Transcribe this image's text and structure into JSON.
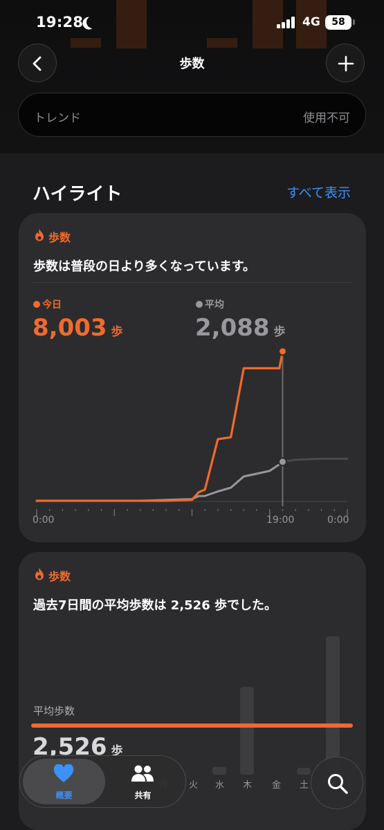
{
  "status_bar": {
    "time": "19:28",
    "network": "4G",
    "battery": "58"
  },
  "nav": {
    "title": "歩数"
  },
  "trend": {
    "label": "トレンド",
    "value": "使用不可"
  },
  "highlights": {
    "title": "ハイライト",
    "show_all": "すべて表示"
  },
  "card1": {
    "category": "歩数",
    "message": "歩数は普段の日より多くなっています。",
    "today_label": "今日",
    "today_value": "8,003",
    "today_unit": "歩",
    "avg_label": "平均",
    "avg_value": "2,088",
    "avg_unit": "歩",
    "x_labels": [
      "0:00",
      "19:00",
      "0:00"
    ]
  },
  "card2": {
    "category": "歩数",
    "message": "過去7日間の平均歩数は 2,526 歩でした。",
    "avg_label": "平均歩数",
    "avg_value": "2,526",
    "avg_unit": "歩",
    "days": [
      "月",
      "火",
      "水",
      "木",
      "金",
      "土",
      "日"
    ]
  },
  "tabs": {
    "overview": "概要",
    "share": "共有"
  },
  "colors": {
    "orange": "#f26a2d",
    "gray": "#98989d",
    "blue": "#3e91f7",
    "card": "#2c2c2e"
  },
  "chart_data": [
    {
      "type": "line",
      "title": "",
      "xlabel": "",
      "ylabel": "",
      "x": [
        "0:00",
        "2:00",
        "4:00",
        "6:00",
        "8:00",
        "10:00",
        "12:00",
        "12:30",
        "13:00",
        "14:00",
        "15:00",
        "16:00",
        "17:00",
        "18:00",
        "18:45",
        "19:00",
        "20:00",
        "22:00",
        "24:00"
      ],
      "series": [
        {
          "name": "今日",
          "values": [
            0,
            0,
            0,
            0,
            0,
            0,
            50,
            450,
            600,
            3300,
            3400,
            7100,
            7100,
            7100,
            7100,
            8003,
            null,
            null,
            null
          ]
        },
        {
          "name": "平均",
          "values": [
            0,
            0,
            0,
            0,
            0,
            50,
            90,
            250,
            260,
            500,
            700,
            1300,
            1450,
            1600,
            1950,
            2088,
            2200,
            2250,
            2250
          ]
        }
      ]
    },
    {
      "type": "bar",
      "title": "",
      "categories": [
        "月",
        "火",
        "水",
        "木",
        "金",
        "土",
        "日"
      ],
      "values": [
        0,
        0,
        400,
        4500,
        0,
        350,
        7100
      ],
      "average": 2526
    }
  ]
}
